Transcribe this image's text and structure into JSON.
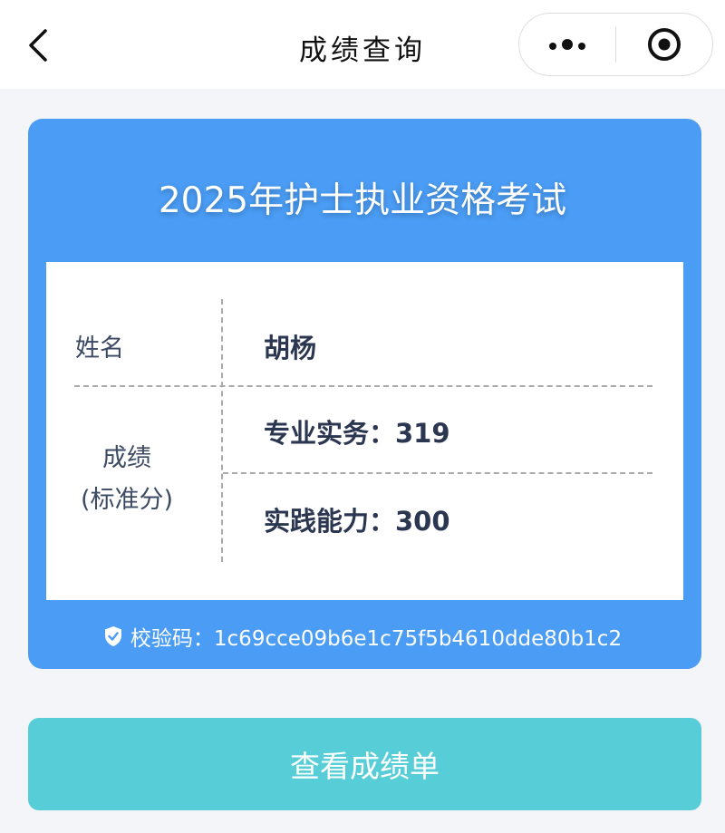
{
  "navbar": {
    "title": "成绩查询",
    "back_icon": "chevron-left-icon",
    "more_icon": "more-dots-icon",
    "close_icon": "target-close-icon"
  },
  "card": {
    "title": "2025年护士执业资格考试",
    "name_label": "姓名",
    "name_value": "胡杨",
    "score_label_line1": "成绩",
    "score_label_line2": "(标准分)",
    "scores": [
      {
        "text": "专业实务：319"
      },
      {
        "text": "实践能力：300"
      }
    ],
    "verify_text": "校验码：1c69cce09b6e1c75f5b4610dde80b1c2",
    "colors": {
      "card": "#4a9cf4",
      "panel": "#ffffff"
    }
  },
  "action": {
    "label": "查看成绩单",
    "color": "#56cdd7"
  }
}
